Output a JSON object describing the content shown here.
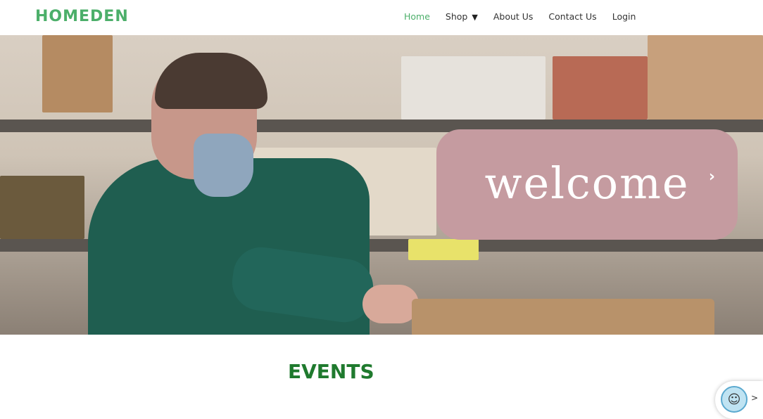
{
  "header": {
    "logo": "HOMEDEN",
    "nav": {
      "home": "Home",
      "shop": "Shop",
      "shop_caret": "▼",
      "about": "About Us",
      "contact": "Contact Us",
      "login": "Login"
    }
  },
  "hero": {
    "welcome": "welcome",
    "next_arrow": "›"
  },
  "events": {
    "title": "EVENTS"
  },
  "chat": {
    "avatar_glyph": "☺",
    "arrow": ">"
  },
  "colors": {
    "brand_green": "#4caf6a",
    "events_green": "#1f7a2e",
    "welcome_box": "#c59ba0"
  }
}
